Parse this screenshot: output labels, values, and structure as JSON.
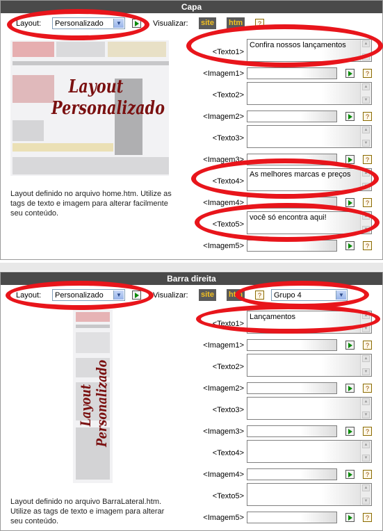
{
  "capa": {
    "title": "Capa",
    "layout_label": "Layout:",
    "layout_value": "Personalizado",
    "view_label": "Visualizar:",
    "view_site": "site",
    "view_htm": "htm",
    "help": "?",
    "watermark_line1": "Layout",
    "watermark_line2": "Personalizado",
    "description": "Layout definido no arquivo home.htm. Utilize as tags de texto e imagem para alterar facilmente seu conteúdo.",
    "fields": [
      {
        "label": "<Texto1>",
        "type": "text",
        "value": "Confira nossos lançamentos"
      },
      {
        "label": "<Imagem1>",
        "type": "image",
        "value": ""
      },
      {
        "label": "<Texto2>",
        "type": "text",
        "value": ""
      },
      {
        "label": "<Imagem2>",
        "type": "image",
        "value": ""
      },
      {
        "label": "<Texto3>",
        "type": "text",
        "value": ""
      },
      {
        "label": "<Imagem3>",
        "type": "image",
        "value": ""
      },
      {
        "label": "<Texto4>",
        "type": "text",
        "value": "As melhores marcas e preços"
      },
      {
        "label": "<Imagem4>",
        "type": "image",
        "value": ""
      },
      {
        "label": "<Texto5>",
        "type": "text",
        "value": "você só encontra aqui!"
      },
      {
        "label": "<Imagem5>",
        "type": "image",
        "value": ""
      }
    ]
  },
  "barra": {
    "title": "Barra direita",
    "layout_label": "Layout:",
    "layout_value": "Personalizado",
    "view_label": "Visualizar:",
    "view_site": "site",
    "view_htm": "htm",
    "help": "?",
    "group_value": "Grupo 4",
    "watermark_line1": "Layout",
    "watermark_line2": "Personalizado",
    "description": "Layout definido no arquivo BarraLateral.htm. Utilize as tags de texto e imagem para alterar seu conteúdo.",
    "fields": [
      {
        "label": "<Texto1>",
        "type": "text",
        "value": "Lançamentos"
      },
      {
        "label": "<Imagem1>",
        "type": "image",
        "value": ""
      },
      {
        "label": "<Texto2>",
        "type": "text",
        "value": ""
      },
      {
        "label": "<Imagem2>",
        "type": "image",
        "value": ""
      },
      {
        "label": "<Texto3>",
        "type": "text",
        "value": ""
      },
      {
        "label": "<Imagem3>",
        "type": "image",
        "value": ""
      },
      {
        "label": "<Texto4>",
        "type": "text",
        "value": ""
      },
      {
        "label": "<Imagem4>",
        "type": "image",
        "value": ""
      },
      {
        "label": "<Texto5>",
        "type": "text",
        "value": ""
      },
      {
        "label": "<Imagem5>",
        "type": "image",
        "value": ""
      }
    ]
  },
  "icons": {
    "go": "play-arrow-icon",
    "help": "help-icon",
    "dropdown": "chevron-down-icon"
  },
  "colors": {
    "annotation": "#e8151b",
    "header": "#4a4a4a",
    "chip_text": "#f4c020"
  }
}
